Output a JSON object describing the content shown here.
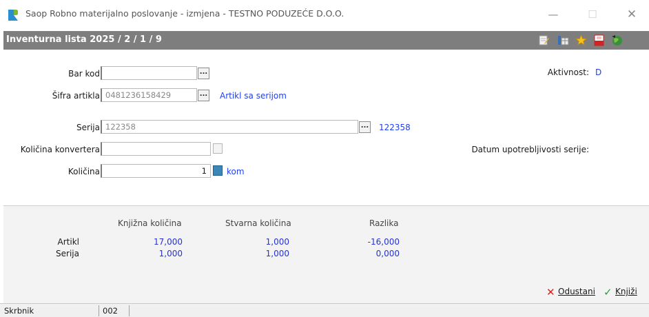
{
  "window": {
    "title": "Saop Robno materijalno poslovanje - izmjena  - TESTNO PODUZEĆE D.O.O.",
    "logo_icon": "app-logo-icon",
    "controls": {
      "minimize": "—",
      "maximize": "☐",
      "close": "✕"
    }
  },
  "header": {
    "title": "Inventurna lista 2025 / 2 / 1 / 9",
    "toolbar_icons": [
      "edit-note-icon",
      "columns-icon",
      "star-icon",
      "pdf-icon",
      "globe-icon"
    ]
  },
  "form": {
    "bar_kod": {
      "label": "Bar kod",
      "value": ""
    },
    "sifra_artikla": {
      "label": "Šifra artikla",
      "value": "0481236158429",
      "note": "Artikl sa serijom"
    },
    "serija": {
      "label": "Serija",
      "value": "122358",
      "note": "122358"
    },
    "kolicina_konvertera": {
      "label": "Količina konvertera",
      "value": ""
    },
    "kolicina": {
      "label": "Količina",
      "value": "1",
      "unit": "kom"
    },
    "aktivnost": {
      "label": "Aktivnost:",
      "value": "D"
    },
    "datum_label": "Datum upotrebljivosti serije:",
    "dots_label": "..."
  },
  "stats": {
    "headers": [
      "Knjižna količina",
      "Stvarna količina",
      "Razlika"
    ],
    "rows": [
      {
        "label": "Artikl",
        "values": [
          "17,000",
          "1,000",
          "-16,000"
        ]
      },
      {
        "label": "Serija",
        "values": [
          "1,000",
          "1,000",
          "0,000"
        ]
      }
    ]
  },
  "footer": {
    "cancel_label": "Odustani",
    "book_label": "Knjiži"
  },
  "statusbar": {
    "user": "Skrbnik",
    "code": "002"
  },
  "colors": {
    "header_bg": "#7e7e7e",
    "link_blue": "#1f3ff0",
    "value_blue": "#2331d6",
    "cancel_red": "#d6221e",
    "confirm_green": "#2e9e2e"
  }
}
